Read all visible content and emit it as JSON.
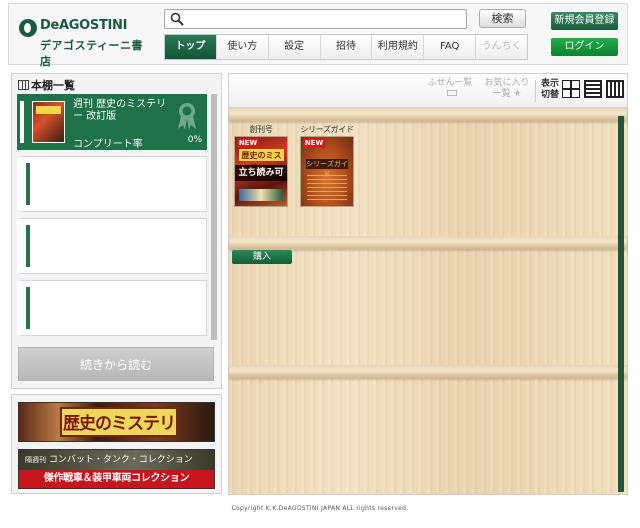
{
  "header": {
    "logo_en": "DeAGOSTINI",
    "logo_ja": "デアゴスティーニ書店",
    "search_placeholder": "",
    "search_button": "検索",
    "nav": [
      "トップ",
      "使い方",
      "設定",
      "招待",
      "利用規約",
      "FAQ",
      "うんちく"
    ],
    "active_nav": "トップ",
    "signup_button": "新規会員登録",
    "login_button": "ログイン"
  },
  "bookshelf_panel": {
    "title": "本棚一覧",
    "items": [
      {
        "title": "週刊 歴史のミステリー 改訂版",
        "rate_label": "コンプリート率",
        "rate": "0%"
      }
    ],
    "continue_button": "続きから読む"
  },
  "banners": {
    "banner1_text": "歴史のミステリー",
    "banner2_top_prefix": "隔週刊",
    "banner2_top": "コンバット・タンク・コレクション",
    "banner2_bottom": "傑作戦車＆装甲車両コレクション"
  },
  "toolbar": {
    "fusen": "ふせん一覧",
    "favorite": "お気に入り",
    "favorite_sub": "一覧",
    "view_label_1": "表示",
    "view_label_2": "切替"
  },
  "shelf": {
    "books": [
      {
        "caption": "創刊号",
        "badge": "NEW",
        "cover_title": "歴史のミステリー",
        "overlay": "立ち読み可",
        "buy_button": "購入"
      },
      {
        "caption": "シリーズガイド",
        "badge": "NEW",
        "cover_title": "シリーズガイド"
      }
    ]
  },
  "footer": "Copyright K.K.DeAGOSTINI JAPAN ALL rights reserved.",
  "colors": {
    "brand_green": "#1a5a3e",
    "accent_green": "#0d8232",
    "new_red": "#d61a1a"
  }
}
